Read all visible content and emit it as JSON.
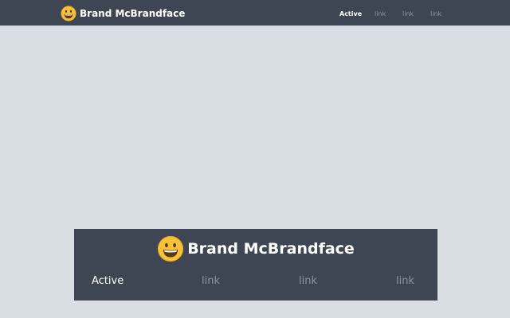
{
  "brand": {
    "name": "Brand McBrandface",
    "icon": "smiley-face-icon"
  },
  "nav": {
    "items": [
      {
        "label": "Active",
        "active": true
      },
      {
        "label": "link",
        "active": false
      },
      {
        "label": "link",
        "active": false
      },
      {
        "label": "link",
        "active": false
      }
    ]
  },
  "colors": {
    "background": "#d9dee5",
    "navbar": "#3d4652",
    "text_active": "#ffffff",
    "text_link": "#8d949d",
    "emoji_face": "#f7c23a"
  }
}
